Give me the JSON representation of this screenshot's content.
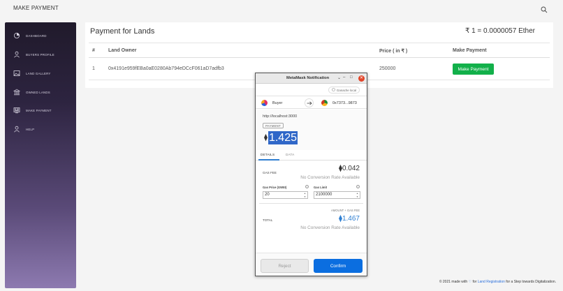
{
  "topbar": {
    "title": "MAKE PAYMENT"
  },
  "sidebar": {
    "items": [
      {
        "label": "DASHBOARD"
      },
      {
        "label": "BUYERS PROFILE"
      },
      {
        "label": "LAND GALLERY"
      },
      {
        "label": "OWNED LANDS"
      },
      {
        "label": "MAKE PAYMENT"
      },
      {
        "label": "HELP"
      }
    ]
  },
  "card": {
    "title": "Payment for Lands",
    "rate": "₹ 1 = 0.0000057 Ether",
    "columns": [
      "#",
      "Land Owner",
      "Price ( in ₹ )",
      "Make Payment"
    ],
    "rows": [
      {
        "index": "1",
        "owner": "0x4191e959fEBa0aE0280Ab794eDCcF061aD7adfb3",
        "price": "250000",
        "action": "Make Payment"
      }
    ]
  },
  "metamask": {
    "title": "MetaMask Notification",
    "window_min": "‒",
    "window_max": "□",
    "window_close": "✕",
    "chevron": "⌄",
    "network": "Ganache local",
    "from": "Buyer",
    "to": "0x7373...9873",
    "origin": "http://localhost:3000",
    "tx_type": "PAYMENT",
    "amount": "1.425",
    "tabs": {
      "details": "DETAILS",
      "data": "DATA"
    },
    "gas_fee_label": "GAS FEE",
    "gas_fee": "0.042",
    "no_conversion": "No Conversion Rate Available",
    "gas_price_label": "Gas Price (GWEI)",
    "gas_price": "20",
    "gas_limit_label": "Gas Limit",
    "gas_limit": "2100000",
    "amount_gas_label": "AMOUNT + GAS FEE",
    "total_label": "TOTAL",
    "total": "1.467",
    "reject": "Reject",
    "confirm": "Confirm"
  },
  "footer": {
    "prefix": "© 2021 made with",
    "mid": "for",
    "link": "Land Registration",
    "suffix": "for a Step towards Digitalization."
  },
  "colors": {
    "accent_green": "#12b04a",
    "metamask_blue": "#0b6ee0",
    "sidebar_top": "#201a2b",
    "sidebar_bottom": "#8d7ab0"
  }
}
